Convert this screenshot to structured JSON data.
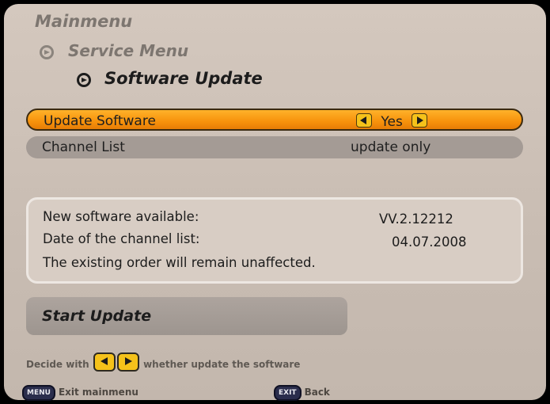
{
  "breadcrumb": {
    "level1": "Mainmenu",
    "level2": "Service Menu",
    "level3": "Software Update"
  },
  "menu": {
    "items": [
      {
        "label": "Update Software",
        "value": "Yes",
        "selected": true
      },
      {
        "label": "Channel List",
        "value": "update only",
        "selected": false
      }
    ]
  },
  "info": {
    "new_software_label": "New software available:",
    "new_software_value": "VV.2.12212",
    "channel_list_date_label": "Date of the channel list:",
    "channel_list_date_value": "04.07.2008",
    "note": "The existing order will remain unaffected."
  },
  "action": {
    "start_update_label": "Start Update"
  },
  "hint": {
    "prefix": "Decide with",
    "suffix": "whether update the software"
  },
  "footer": {
    "menu_key": "MENU",
    "menu_label": "Exit mainmenu",
    "exit_key": "EXIT",
    "exit_label": "Back"
  },
  "colors": {
    "panel": "#d4c8be",
    "highlight": "#f7920c",
    "key": "#f5c21a"
  },
  "icons": [
    "breadcrumb-arrow-icon",
    "left-key-icon",
    "right-key-icon",
    "menu-button-icon",
    "exit-button-icon"
  ]
}
